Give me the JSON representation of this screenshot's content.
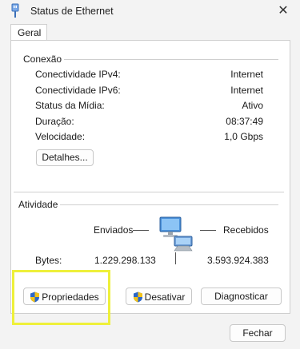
{
  "window": {
    "title": "Status de Ethernet",
    "close_glyph": "✕"
  },
  "tabs": [
    {
      "label": "Geral"
    }
  ],
  "connection": {
    "title": "Conexão",
    "rows": [
      {
        "label": "Conectividade IPv4:",
        "value": "Internet"
      },
      {
        "label": "Conectividade IPv6:",
        "value": "Internet"
      },
      {
        "label": "Status da Mídia:",
        "value": "Ativo"
      },
      {
        "label": "Duração:",
        "value": "08:37:49"
      },
      {
        "label": "Velocidade:",
        "value": "1,0 Gbps"
      }
    ],
    "details_button": "Detalhes..."
  },
  "activity": {
    "title": "Atividade",
    "sent_label": "Enviados",
    "received_label": "Recebidos",
    "bytes_label": "Bytes:",
    "bytes_sent": "1.229.298.133",
    "bytes_received": "3.593.924.383",
    "network_icon": "network-computers-icon"
  },
  "buttons": {
    "properties": "Propriedades",
    "disable": "Desativar",
    "diagnose": "Diagnosticar",
    "close": "Fechar"
  },
  "colors": {
    "highlight": "#eef03a",
    "shield_blue": "#2a66c9",
    "shield_yellow": "#f2c21b"
  }
}
